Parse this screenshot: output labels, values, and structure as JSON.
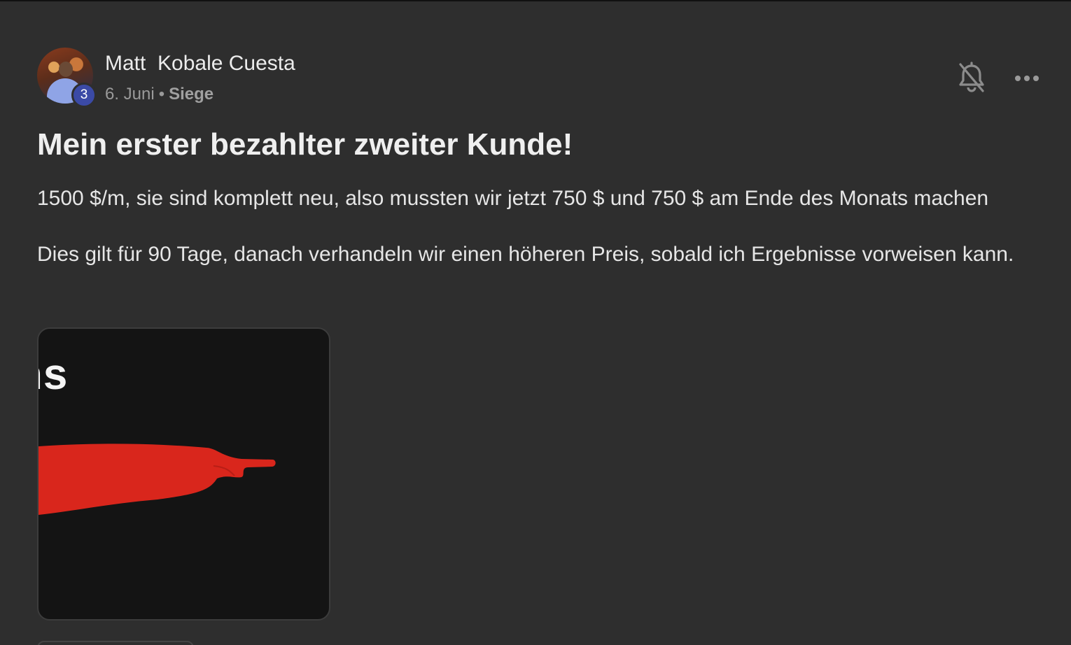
{
  "post": {
    "author": {
      "name": "Matt  Kobale Cuesta",
      "level": "3"
    },
    "date": "6. Juni",
    "separator": "•",
    "category": "Siege",
    "title": "Mein erster bezahlter zweiter Kunde!",
    "paragraphs": [
      "1500 $/m, sie sind komplett neu, also mussten wir jetzt 750 $ und 750 $ am Ende des Monats machen",
      "Dies gilt für 90 Tage, danach verhandeln wir einen höheren Preis, sobald ich Ergebnisse vorweisen kann."
    ],
    "attachment": {
      "visible_text": "ns"
    },
    "actions": {
      "bell_icon": "bell-off-icon",
      "more_icon": "more-horizontal-icon"
    }
  },
  "colors": {
    "card_background": "#2e2e2e",
    "level_badge": "#3b4aa6",
    "attachment_background": "#141414",
    "attachment_accent": "#d9261c"
  }
}
